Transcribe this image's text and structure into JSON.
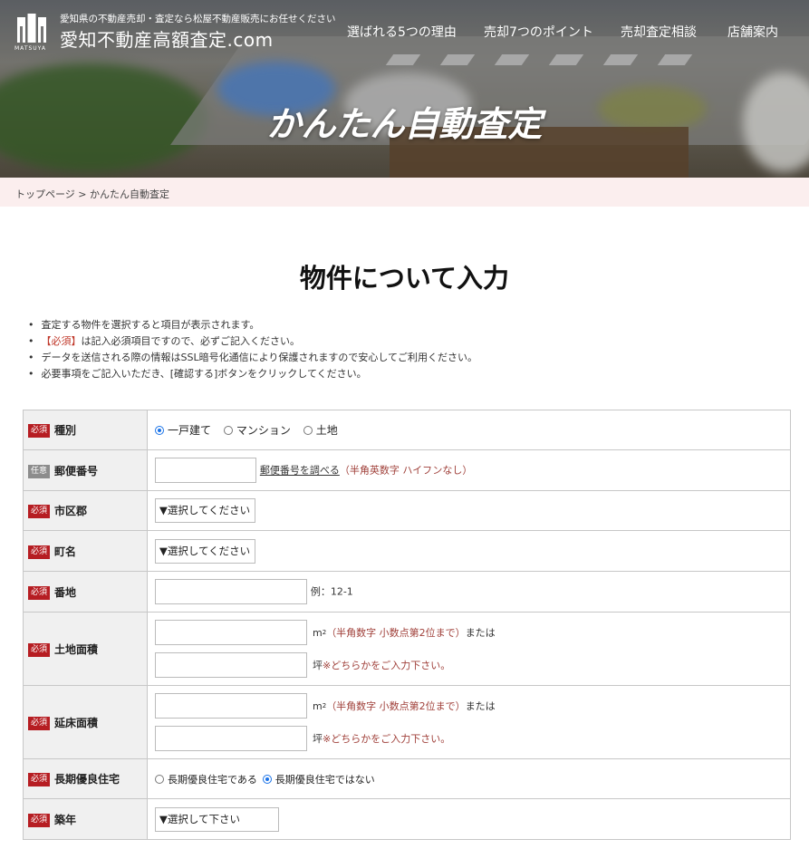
{
  "header": {
    "tagline": "愛知県の不動産売却・査定なら松屋不動産販売にお任せください",
    "site_name": "愛知不動産高額査定.com",
    "logo_text": "MATSUYA",
    "nav": [
      "選ばれる5つの理由",
      "売却7つのポイント",
      "売却査定相談",
      "店舗案内"
    ],
    "hero_title": "かんたん自動査定"
  },
  "breadcrumb": "トップページ > かんたん自動査定",
  "section_title": "物件について入力",
  "notes": [
    {
      "pre": "",
      "req": "",
      "text": "査定する物件を選択すると項目が表示されます。"
    },
    {
      "pre": "",
      "req": "【必須】",
      "text": "は記入必須項目ですので、必ずご記入ください。"
    },
    {
      "pre": "",
      "req": "",
      "text": "データを送信される際の情報はSSL暗号化通信により保護されますので安心してご利用ください。"
    },
    {
      "pre": "",
      "req": "",
      "text": "必要事項をご記入いただき、[確認する]ボタンをクリックしてください。"
    }
  ],
  "badges": {
    "required": "必須",
    "optional": "任意"
  },
  "form": {
    "type": {
      "label": "種別",
      "options": [
        "一戸建て",
        "マンション",
        "土地"
      ],
      "selected": "一戸建て"
    },
    "zip": {
      "label": "郵便番号",
      "value": "",
      "lookup_link": "郵便番号を調べる",
      "hint": "（半角英数字 ハイフンなし）"
    },
    "city": {
      "label": "市区郡",
      "selected": "▼選択してください"
    },
    "town": {
      "label": "町名",
      "selected": "▼選択してください"
    },
    "lot": {
      "label": "番地",
      "value": "",
      "example": "例：12-1"
    },
    "land_area": {
      "label": "土地面積",
      "m2_value": "",
      "tsubo_value": "",
      "unit_m2": "m",
      "sup": "2",
      "hint_m2": "（半角数字 小数点第2位まで）",
      "or": "または",
      "unit_tsubo": "坪",
      "hint_tsubo": "※どちらかをご入力下さい。"
    },
    "floor_area": {
      "label": "延床面積",
      "m2_value": "",
      "tsubo_value": "",
      "unit_m2": "m",
      "sup": "2",
      "hint_m2": "（半角数字 小数点第2位まで）",
      "or": "または",
      "unit_tsubo": "坪",
      "hint_tsubo": "※どちらかをご入力下さい。"
    },
    "long_term": {
      "label": "長期優良住宅",
      "options": [
        "長期優良住宅である",
        "長期優良住宅ではない"
      ],
      "selected": "長期優良住宅ではない"
    },
    "built_year": {
      "label": "築年",
      "selected": "▼選択して下さい"
    }
  },
  "colors": {
    "required_badge": "#b61d22",
    "optional_badge": "#8c8c8c",
    "breadcrumb_bg": "#fbeeee",
    "hint": "#a0403a"
  }
}
